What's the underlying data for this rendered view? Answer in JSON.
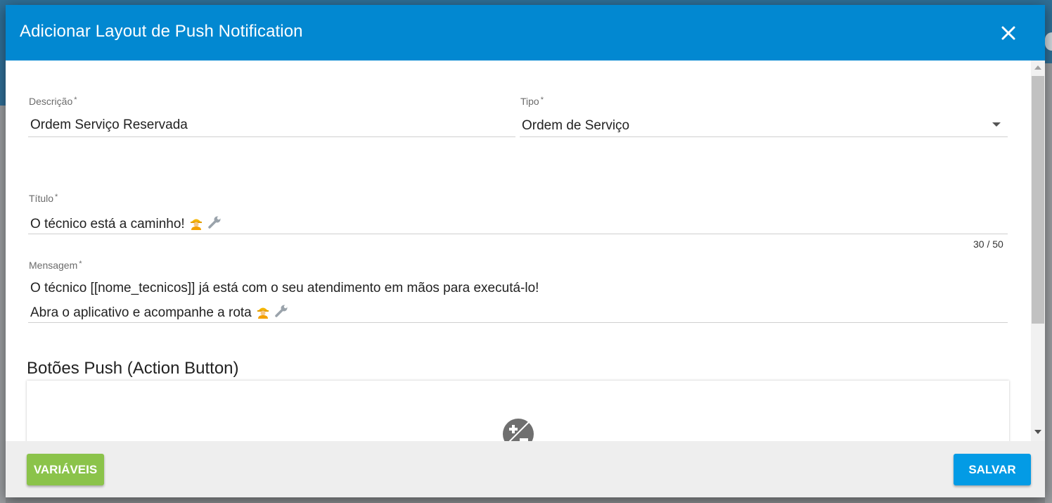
{
  "dialog": {
    "title": "Adicionar Layout de Push Notification",
    "close_icon": "close-icon"
  },
  "form": {
    "descricao": {
      "label": "Descrição",
      "required_mark": "*",
      "value": "Ordem Serviço Reservada"
    },
    "tipo": {
      "label": "Tipo",
      "required_mark": "*",
      "value": "Ordem de Serviço",
      "icon": "dropdown-caret-icon"
    },
    "titulo": {
      "label": "Título",
      "required_mark": "*",
      "value": "O técnico está a caminho!",
      "emoji": [
        "construction-worker-icon",
        "wrench-icon"
      ],
      "counter": "30 / 50"
    },
    "mensagem": {
      "label": "Mensagem",
      "required_mark": "*",
      "line1": "O técnico [[nome_tecnicos]] já está com o seu atendimento em mãos para executá-lo!",
      "line2": "Abra o aplicativo e acompanhe a rota",
      "emoji": [
        "construction-worker-icon",
        "wrench-icon"
      ]
    }
  },
  "action_buttons": {
    "title": "Botões Push (Action Button)",
    "add_icon": "add-remove-circle-icon"
  },
  "footer": {
    "variables_label": "VARIÁVEIS",
    "save_label": "SALVAR"
  },
  "colors": {
    "header": "#0288d1",
    "variables_button": "#8bc34a",
    "save_button": "#039be5"
  }
}
